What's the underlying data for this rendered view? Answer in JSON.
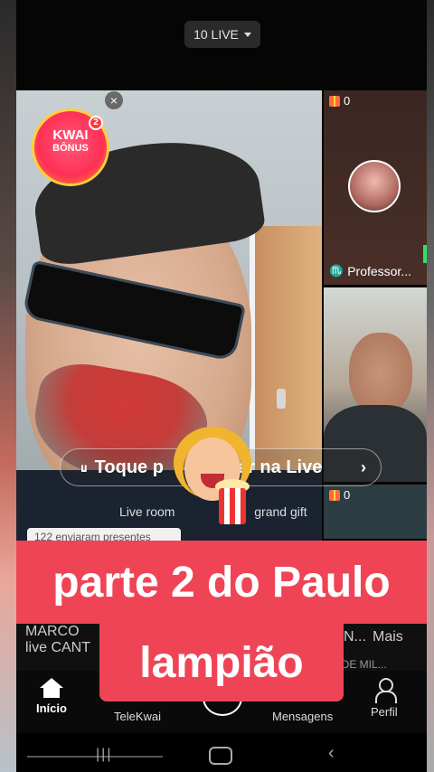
{
  "header": {
    "live_count": "10 LIVE"
  },
  "main_stream": {
    "close": "×",
    "bonus": {
      "line1": "KWAI",
      "line2": "BÔNUS",
      "badge": "2"
    },
    "toque_pill": "Toque p",
    "toque_pill_rest": "ar na Live",
    "live_room_text": "Live room",
    "live_room_rest": "grand gift",
    "sent_text": "122 enviaram presentes"
  },
  "side_tiles": [
    {
      "gift_count": "0",
      "host_name": "Professor..."
    },
    {
      "gift_count": "0"
    }
  ],
  "behind_banner": {
    "left_line1": "MARCO",
    "left_line2": "live CANT",
    "right_word": "N...",
    "right_more": "Mais",
    "right_tag": "IRA DE MIL..."
  },
  "overlay_banner": {
    "line1": "parte 2 do Paulo",
    "line2": "lampião"
  },
  "bottom_nav": {
    "items": [
      {
        "label": "Início",
        "icon": "home-icon"
      },
      {
        "label": "TeleKwai",
        "icon": "tv-icon"
      },
      {
        "label": "+",
        "icon": "plus-icon"
      },
      {
        "label": "Mensagens",
        "icon": "message-icon"
      },
      {
        "label": "Perfil",
        "icon": "profile-icon"
      }
    ]
  },
  "colors": {
    "banner_red": "#ef4456",
    "accent_green": "#2ee06a"
  }
}
